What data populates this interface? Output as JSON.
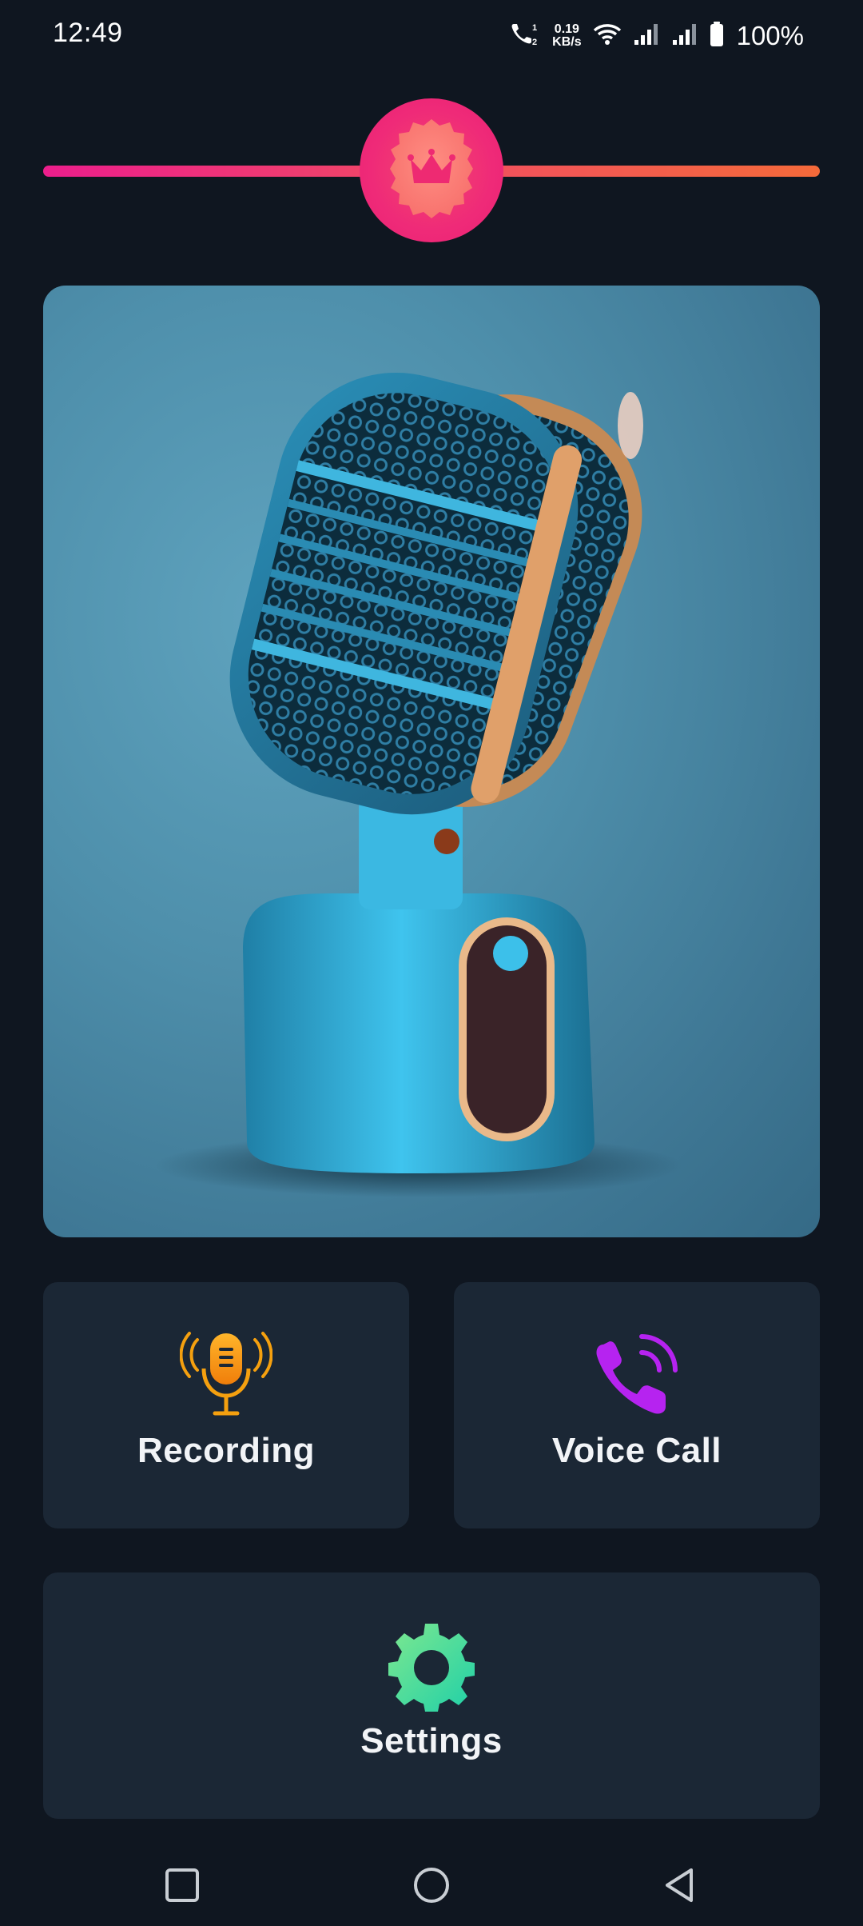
{
  "status_bar": {
    "time": "12:49",
    "net_speed_value": "0.19",
    "net_speed_unit": "KB/s",
    "battery_percent": "100%",
    "icons": [
      "call-sim-icon",
      "wifi-icon",
      "signal-icon",
      "signal-icon",
      "battery-icon"
    ]
  },
  "premium": {
    "icon": "crown-icon",
    "colors": {
      "bar_start": "#ec1e8c",
      "bar_end": "#f46a3a",
      "badge": "#ef2a78"
    }
  },
  "hero": {
    "icon": "microphone-illustration"
  },
  "menu": {
    "recording": {
      "label": "Recording",
      "icon": "microphone-icon",
      "color": "#f5a00f"
    },
    "voice_call": {
      "label": "Voice Call",
      "icon": "phone-icon",
      "color": "#b623f0"
    },
    "settings": {
      "label": "Settings",
      "icon": "gear-icon",
      "color": "#3ee0a0"
    }
  },
  "nav": {
    "icons": [
      "recents-icon",
      "home-icon",
      "back-icon"
    ]
  }
}
